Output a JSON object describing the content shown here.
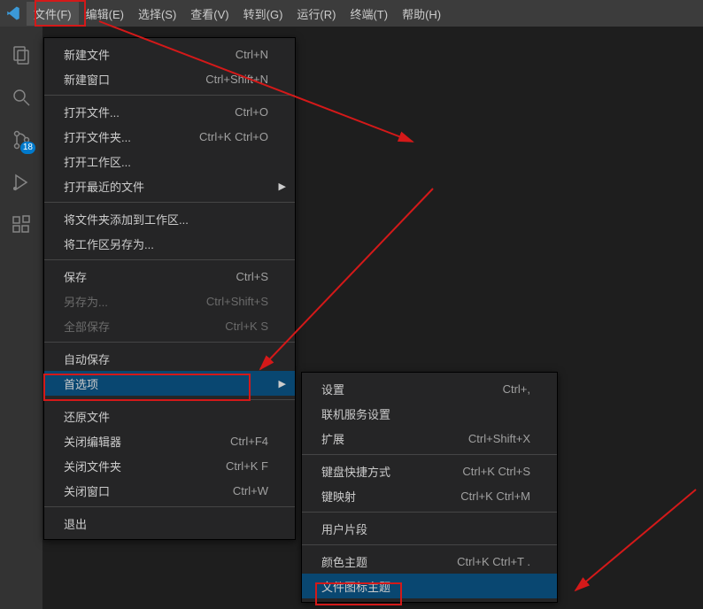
{
  "menubar": {
    "items": [
      {
        "label": "文件(F)"
      },
      {
        "label": "编辑(E)"
      },
      {
        "label": "选择(S)"
      },
      {
        "label": "查看(V)"
      },
      {
        "label": "转到(G)"
      },
      {
        "label": "运行(R)"
      },
      {
        "label": "终端(T)"
      },
      {
        "label": "帮助(H)"
      }
    ]
  },
  "activity": {
    "scm_badge": "18"
  },
  "file_menu": {
    "groups": [
      [
        {
          "label": "新建文件",
          "hotkey": "Ctrl+N"
        },
        {
          "label": "新建窗口",
          "hotkey": "Ctrl+Shift+N"
        }
      ],
      [
        {
          "label": "打开文件...",
          "hotkey": "Ctrl+O"
        },
        {
          "label": "打开文件夹...",
          "hotkey": "Ctrl+K Ctrl+O"
        },
        {
          "label": "打开工作区..."
        },
        {
          "label": "打开最近的文件",
          "submenu": true
        }
      ],
      [
        {
          "label": "将文件夹添加到工作区..."
        },
        {
          "label": "将工作区另存为..."
        }
      ],
      [
        {
          "label": "保存",
          "hotkey": "Ctrl+S"
        },
        {
          "label": "另存为...",
          "hotkey": "Ctrl+Shift+S",
          "disabled": true
        },
        {
          "label": "全部保存",
          "hotkey": "Ctrl+K S",
          "disabled": true
        }
      ],
      [
        {
          "label": "自动保存"
        },
        {
          "label": "首选项",
          "submenu": true,
          "hover": true
        }
      ],
      [
        {
          "label": "还原文件"
        },
        {
          "label": "关闭编辑器",
          "hotkey": "Ctrl+F4"
        },
        {
          "label": "关闭文件夹",
          "hotkey": "Ctrl+K F"
        },
        {
          "label": "关闭窗口",
          "hotkey": "Ctrl+W"
        }
      ],
      [
        {
          "label": "退出"
        }
      ]
    ]
  },
  "pref_menu": {
    "groups": [
      [
        {
          "label": "设置",
          "hotkey": "Ctrl+,"
        },
        {
          "label": "联机服务设置"
        },
        {
          "label": "扩展",
          "hotkey": "Ctrl+Shift+X"
        }
      ],
      [
        {
          "label": "键盘快捷方式",
          "hotkey": "Ctrl+K Ctrl+S"
        },
        {
          "label": "键映射",
          "hotkey": "Ctrl+K Ctrl+M"
        }
      ],
      [
        {
          "label": "用户片段"
        }
      ],
      [
        {
          "label": "颜色主题",
          "hotkey": "Ctrl+K Ctrl+T ."
        },
        {
          "label": "文件图标主题",
          "hover": true
        }
      ]
    ]
  }
}
